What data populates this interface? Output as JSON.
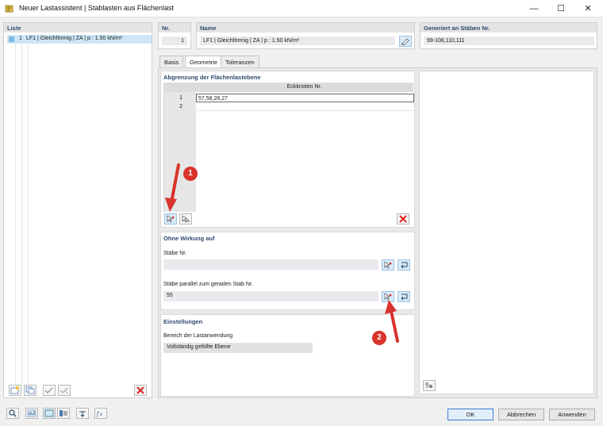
{
  "window": {
    "title": "Neuer Lastassistent | Stablasten aus Flächenlast",
    "controls": {
      "minimize": "—",
      "maximize": "☐",
      "close": "✕"
    }
  },
  "list_panel": {
    "header": "Liste",
    "items": [
      {
        "number": "1",
        "text": "LF1 | Gleichförmig | ZA | p : 1.50 kN/m²",
        "swatch_color": "#7fb8e3"
      }
    ]
  },
  "info": {
    "nr_label": "Nr.",
    "nr_value": "1",
    "name_label": "Name",
    "name_value": "LF1 | Gleichförmig | ZA | p : 1.50 kN/m²",
    "generated_label": "Generiert an Stäben Nr.",
    "generated_value": "99-108,110,111"
  },
  "tabs": [
    {
      "label": "Basis"
    },
    {
      "label": "Geometrie"
    },
    {
      "label": "Toleranzen"
    }
  ],
  "boundary": {
    "title": "Abgrenzung der Flächenlastebene",
    "column_header": "Eckknoten Nr.",
    "rows": [
      {
        "num": "1",
        "value": "57,58,28,27"
      },
      {
        "num": "2",
        "value": ""
      }
    ]
  },
  "no_effect": {
    "title": "Ohne Wirkung auf",
    "members_label": "Stäbe Nr.",
    "members_value": "",
    "parallel_label": "Stäbe parallel zum geraden Stab Nr.",
    "parallel_value": "55"
  },
  "settings": {
    "title": "Einstellungen",
    "range_label": "Bereich der Lastanwendung",
    "range_value": "Vollständig gefüllte Ebene"
  },
  "annotations": [
    {
      "number": "1"
    },
    {
      "number": "2"
    }
  ],
  "buttons": {
    "ok": "OK",
    "cancel": "Abbrechen",
    "apply": "Anwenden"
  },
  "colors": {
    "accent": "#2c4a6e",
    "selection": "#cde6f7",
    "annotation": "#d9332c",
    "delete": "#e02020"
  }
}
